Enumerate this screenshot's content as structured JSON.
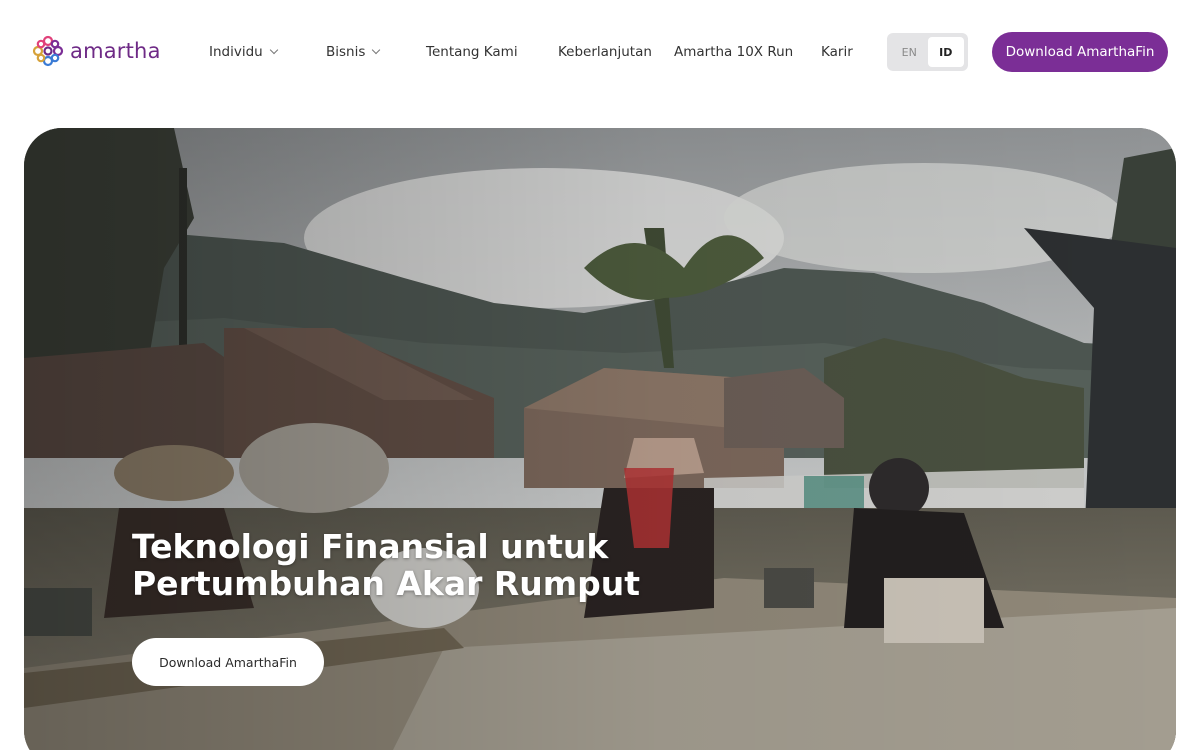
{
  "brand": {
    "name": "amartha",
    "logo_icon": "amartha-flower-icon",
    "color": "#6e2a86"
  },
  "nav": {
    "items": [
      {
        "label": "Individu",
        "dropdown": true
      },
      {
        "label": "Bisnis",
        "dropdown": true
      },
      {
        "label": "Tentang Kami",
        "dropdown": false
      },
      {
        "label": "Keberlanjutan",
        "dropdown": false
      },
      {
        "label": "Amartha 10X Run",
        "dropdown": false
      },
      {
        "label": "Karir",
        "dropdown": false
      }
    ]
  },
  "language": {
    "options": [
      "EN",
      "ID"
    ],
    "selected": "ID"
  },
  "header_cta": {
    "label": "Download AmarthaFin",
    "color": "#7b2e96"
  },
  "hero": {
    "title_line1": "Teknologi Finansial untuk",
    "title_line2": "Pertumbuhan Akar Rumput",
    "cta_label": "Download AmarthaFin"
  }
}
